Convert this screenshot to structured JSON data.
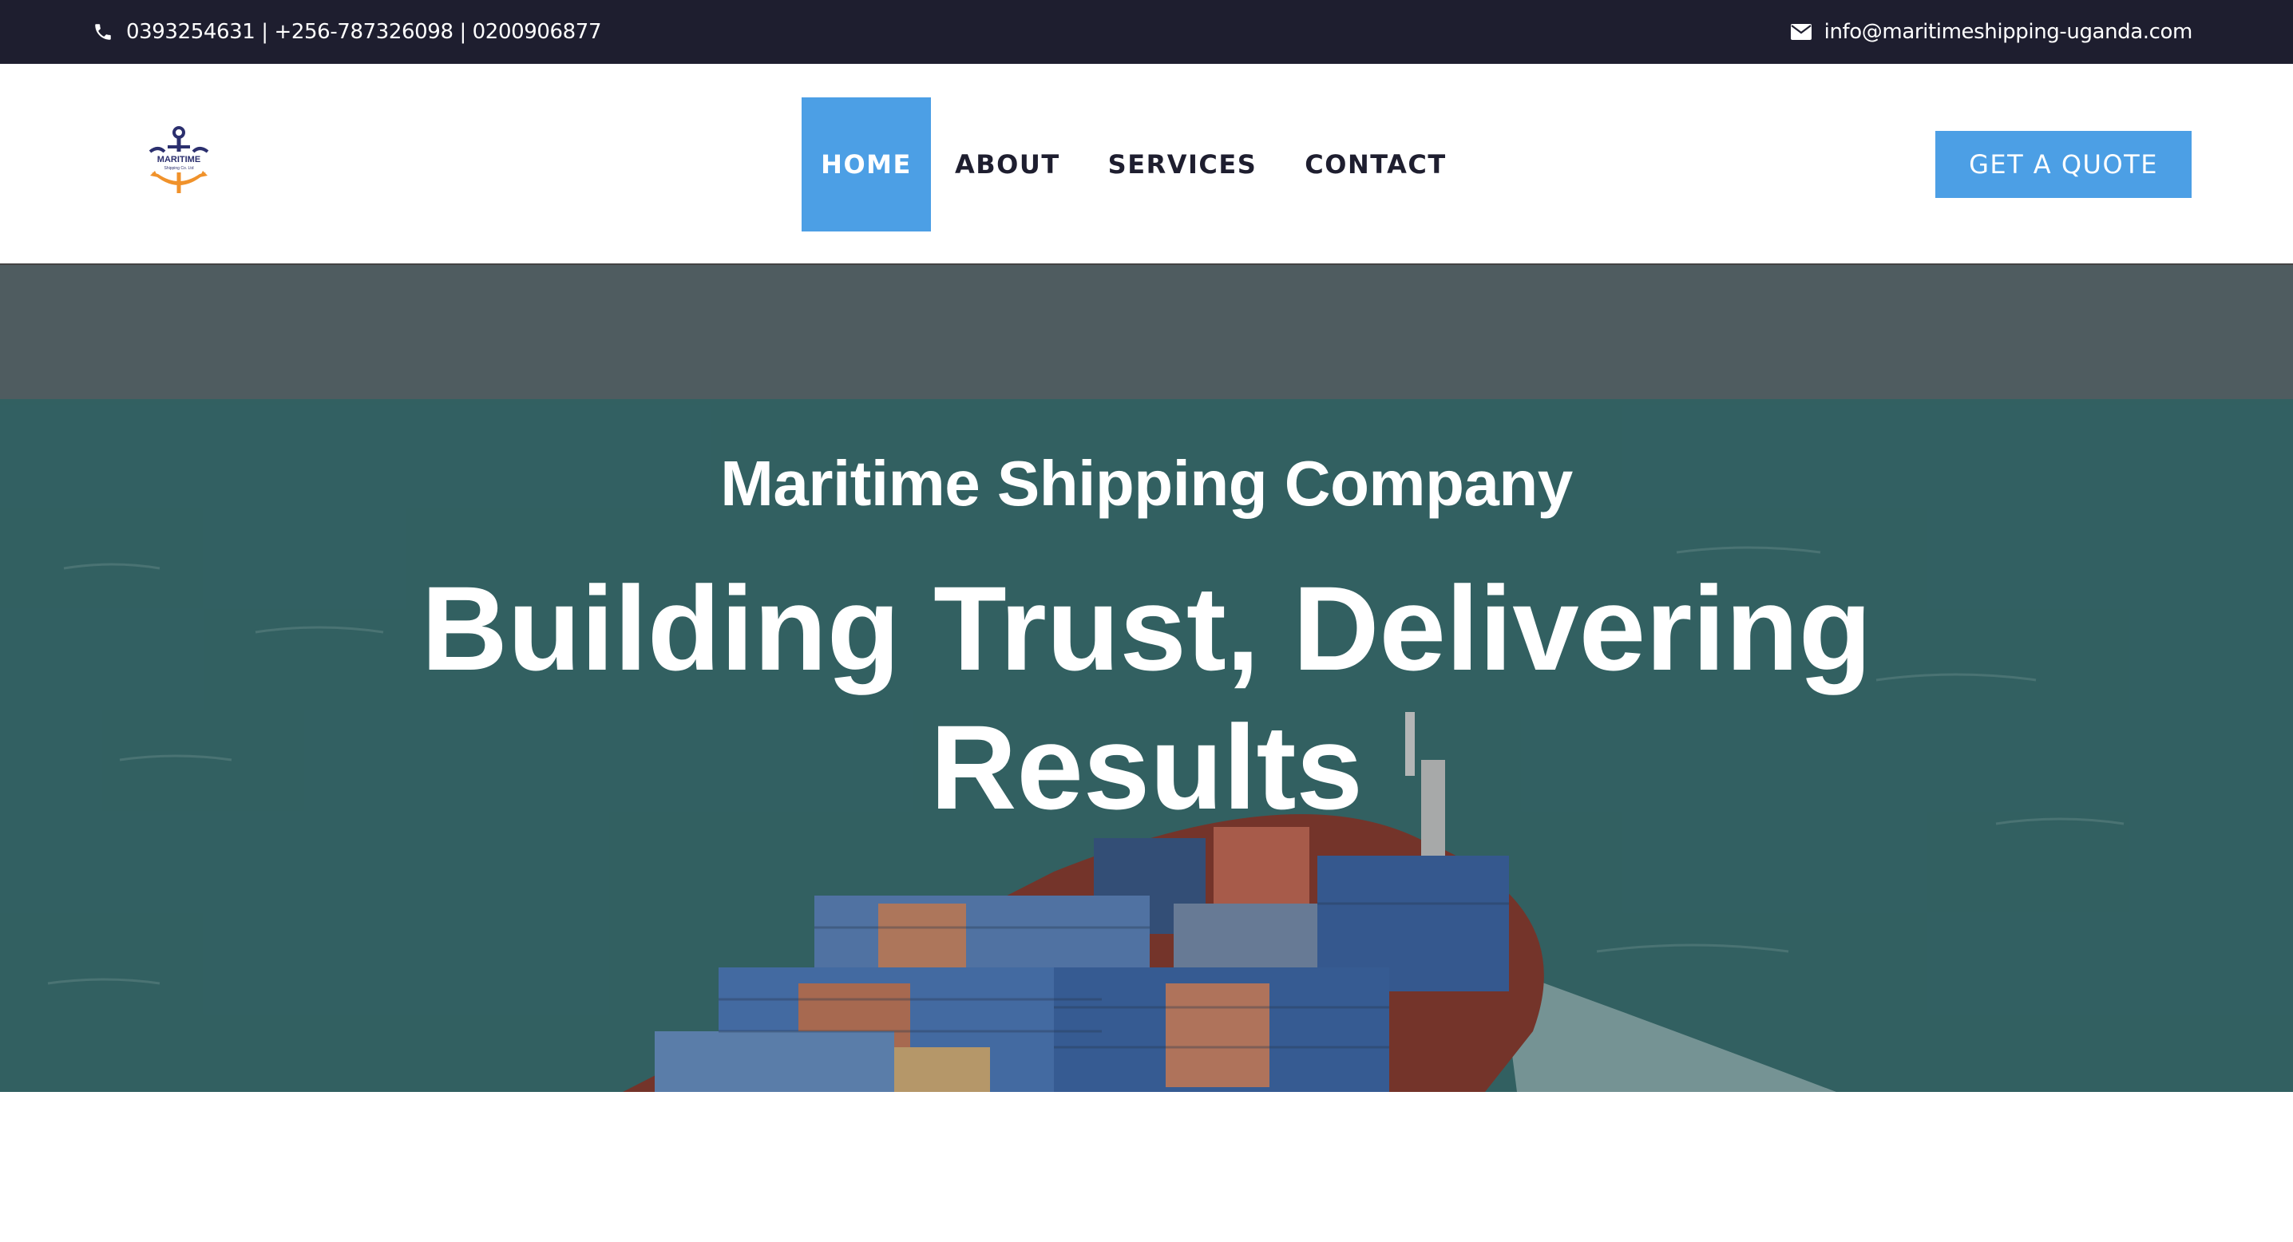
{
  "topbar": {
    "phone_icon": "phone-icon",
    "phone": "0393254631 | +256-787326098 | 0200906877",
    "email_icon": "envelope-icon",
    "email": "info@maritimeshipping-uganda.com"
  },
  "header": {
    "logo": {
      "icon": "anchor-logo",
      "text": "MARITIME",
      "tagline": "Shipping Co. Ltd"
    },
    "nav": [
      {
        "label": "HOME",
        "active": true
      },
      {
        "label": "ABOUT",
        "active": false
      },
      {
        "label": "SERVICES",
        "active": false
      },
      {
        "label": "CONTACT",
        "active": false
      }
    ],
    "cta_label": "GET A QUOTE"
  },
  "hero": {
    "subtitle": "Maritime Shipping Company",
    "title": "Building Trust, Delivering Results",
    "background": "container-ship-at-sea"
  },
  "colors": {
    "accent": "#4c9fe5",
    "topbar_bg": "#1e1e2f",
    "nav_text": "#1e1e2f",
    "logo_navy": "#2b2f6e",
    "logo_orange": "#f0922b"
  }
}
